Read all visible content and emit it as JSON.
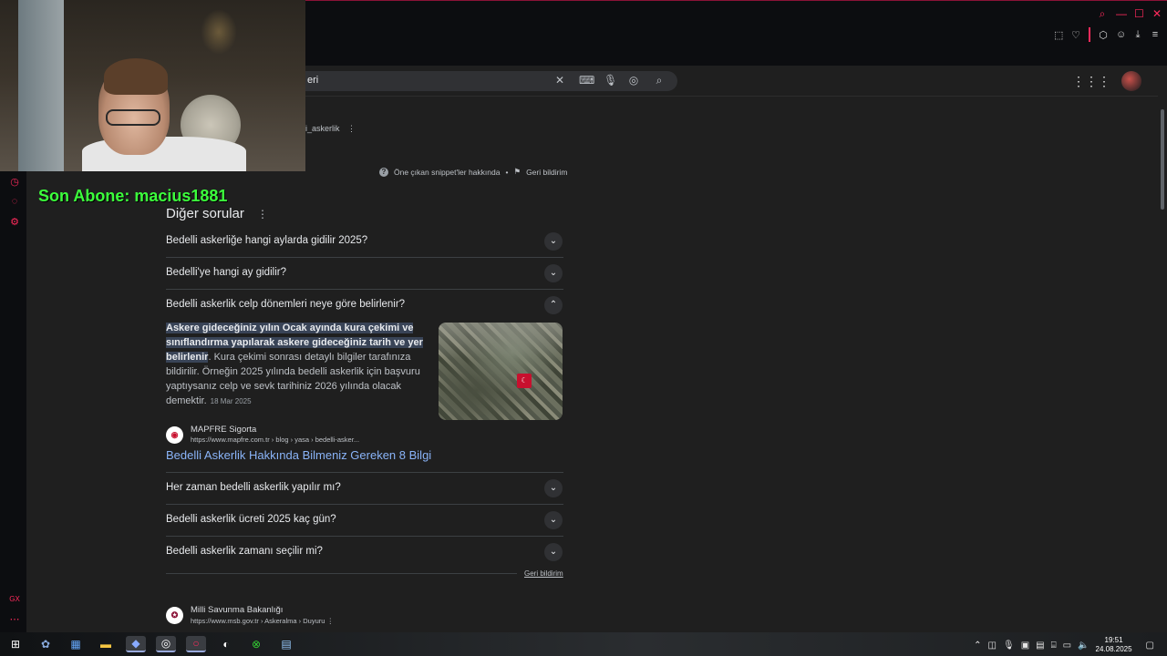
{
  "browser": {
    "window_controls": [
      "search-icon",
      "minimize-icon",
      "maximize-icon",
      "close-icon"
    ],
    "toolbar_icons": [
      "snapshot-icon",
      "heart-icon",
      "extensions-icon",
      "account-icon",
      "download-icon",
      "menu-icon"
    ]
  },
  "search": {
    "query_fragment": "eri",
    "icons": [
      "clear-icon",
      "keyboard-icon",
      "mic-icon",
      "lens-icon",
      "search-icon"
    ]
  },
  "top_fragments": {
    "source_name": "i_askerlik"
  },
  "snippet_meta": {
    "about_label": "Öne çıkan snippet'ler hakkında",
    "feedback_label": "Geri bildirim"
  },
  "overlay": {
    "son_abone": "Son Abone: macius1881"
  },
  "other_questions": {
    "title": "Diğer sorular",
    "items": [
      "Bedelli askerliğe hangi aylarda gidilir 2025?",
      "Bedelli'ye hangi ay gidilir?",
      "Bedelli askerlik celp dönemleri neye göre belirlenir?",
      "Her zaman bedelli askerlik yapılır mı?",
      "Bedelli askerlik ücreti 2025 kaç gün?",
      "Bedelli askerlik zamanı seçilir mi?"
    ],
    "expanded_answer": {
      "highlight": "Askere gideceğiniz yılın Ocak ayında kura çekimi ve sınıflandırma yapılarak askere gideceğiniz tarih ve yer belirlenir",
      "rest": ". Kura çekimi sonrası detaylı bilgiler tarafınıza bildirilir. Örneğin 2025 yılında bedelli askerlik için başvuru yaptıysanız celp ve sevk tarihiniz 2026 yılında olacak demektir.",
      "date": "18 Mar 2025",
      "source_name": "MAPFRE Sigorta",
      "source_url": "https://www.mapfre.com.tr › blog › yasa › bedelli-asker...",
      "link_title": "Bedelli Askerlik Hakkında Bilmeniz Gereken 8 Bilgi"
    },
    "feedback": "Geri bildirim"
  },
  "next_result": {
    "source_name": "Milli Savunma Bakanlığı",
    "source_url": "https://www.msb.gov.tr › Askeralma › Duyuru"
  },
  "taskbar": {
    "time": "19:51",
    "date": "24.08.2025",
    "apps": [
      "windows-icon",
      "copilot-icon",
      "calculator-icon",
      "file-explorer-icon",
      "app-icon",
      "steam-icon",
      "opera-gx-icon",
      "obs-icon",
      "xbox-icon",
      "notepad-icon"
    ]
  },
  "colors": {
    "accent": "#ff2a5c",
    "link": "#8ab4f8",
    "overlay_text": "#3cff3c",
    "highlight_bg": "#394457"
  }
}
